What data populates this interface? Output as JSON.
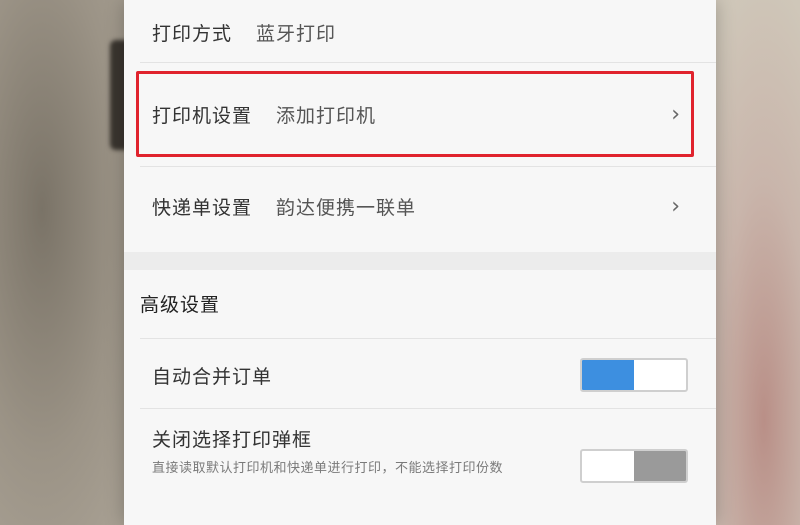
{
  "print_settings": {
    "method": {
      "label": "打印方式",
      "value": "蓝牙打印"
    },
    "printer": {
      "label": "打印机设置",
      "value": "添加打印机",
      "chevron": "›"
    },
    "waybill": {
      "label": "快递单设置",
      "value": "韵达便携一联单",
      "chevron": "›"
    }
  },
  "advanced": {
    "title": "高级设置",
    "auto_merge": {
      "label": "自动合并订单",
      "enabled": true
    },
    "close_dialog": {
      "label": "关闭选择打印弹框",
      "description": "直接读取默认打印机和快递单进行打印，不能选择打印份数",
      "enabled": false
    }
  },
  "colors": {
    "highlight": "#e0232d",
    "toggle_on": "#3d8fe0",
    "toggle_off": "#9a9a9a"
  }
}
